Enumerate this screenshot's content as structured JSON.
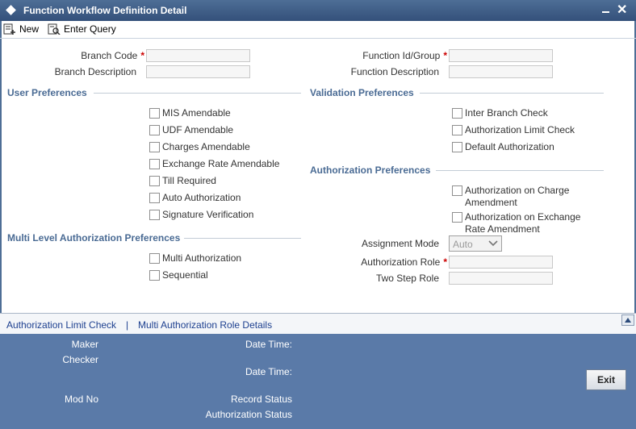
{
  "window": {
    "title": "Function Workflow Definition Detail"
  },
  "toolbar": {
    "new_label": "New",
    "enter_query_label": "Enter Query"
  },
  "header_fields": {
    "branch_code_label": "Branch Code",
    "branch_description_label": "Branch Description",
    "function_id_label": "Function Id/Group",
    "function_description_label": "Function Description",
    "required_mark": "*"
  },
  "user_preferences": {
    "title": "User Preferences",
    "items": [
      "MIS Amendable",
      "UDF Amendable",
      "Charges Amendable",
      "Exchange Rate Amendable",
      "Till Required",
      "Auto Authorization",
      "Signature Verification"
    ]
  },
  "validation_preferences": {
    "title": "Validation Preferences",
    "items": [
      "Inter Branch Check",
      "Authorization Limit Check",
      "Default Authorization"
    ]
  },
  "authorization_preferences": {
    "title": "Authorization Preferences",
    "items": [
      {
        "line1": "Authorization on Charge",
        "line2": "Amendment"
      },
      {
        "line1": "Authorization on Exchange",
        "line2": "Rate Amendment"
      }
    ],
    "assignment_mode_label": "Assignment Mode",
    "assignment_mode_value": "Auto",
    "authorization_role_label": "Authorization Role",
    "two_step_role_label": "Two Step Role"
  },
  "multi_level": {
    "title": "Multi Level Authorization Preferences",
    "items": [
      "Multi Authorization",
      "Sequential"
    ]
  },
  "links": {
    "authorization_limit_check": "Authorization Limit Check",
    "separator": "|",
    "multi_authorization_role_details": "Multi Authorization Role Details"
  },
  "footer": {
    "maker_label": "Maker",
    "checker_label": "Checker",
    "date_time_label": "Date Time:",
    "mod_no_label": "Mod No",
    "record_status_label": "Record Status",
    "authorization_status_label": "Authorization Status",
    "exit_label": "Exit"
  },
  "colors": {
    "title_bar": "#34507a",
    "section_heading": "#4a6b94",
    "footer": "#5a7aa8",
    "link": "#1c3f8f"
  }
}
